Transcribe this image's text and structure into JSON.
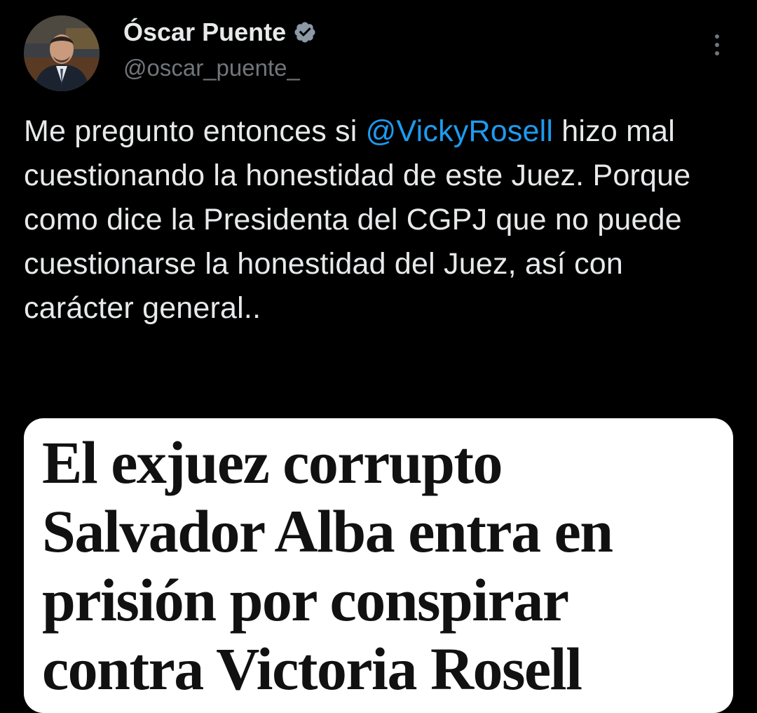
{
  "author": {
    "name": "Óscar Puente",
    "handle": "@oscar_puente_",
    "verified": true,
    "verified_color": "#8b98a5",
    "avatar_icon": "profile-photo"
  },
  "tweet": {
    "text_before_mention": "Me pregunto entonces si ",
    "mention": "@VickyRosell",
    "text_after_mention": " hizo mal cuestionando la honestidad de este Juez. Porque como dice la Presidenta del CGPJ que no puede cuestionarse la honestidad del Juez, así con carácter general..",
    "mention_color": "#1d9bf0"
  },
  "media": {
    "headline_lines": [
      "El exjuez corrupto",
      "Salvador Alba entra en",
      "prisión por conspirar",
      "contra Victoria Rosell"
    ]
  },
  "icons": {
    "more": "more-options-icon",
    "verified": "verified-badge-icon"
  },
  "colors": {
    "background": "#000000",
    "text_primary": "#e7e9ea",
    "text_secondary": "#71767b",
    "accent": "#1d9bf0"
  }
}
